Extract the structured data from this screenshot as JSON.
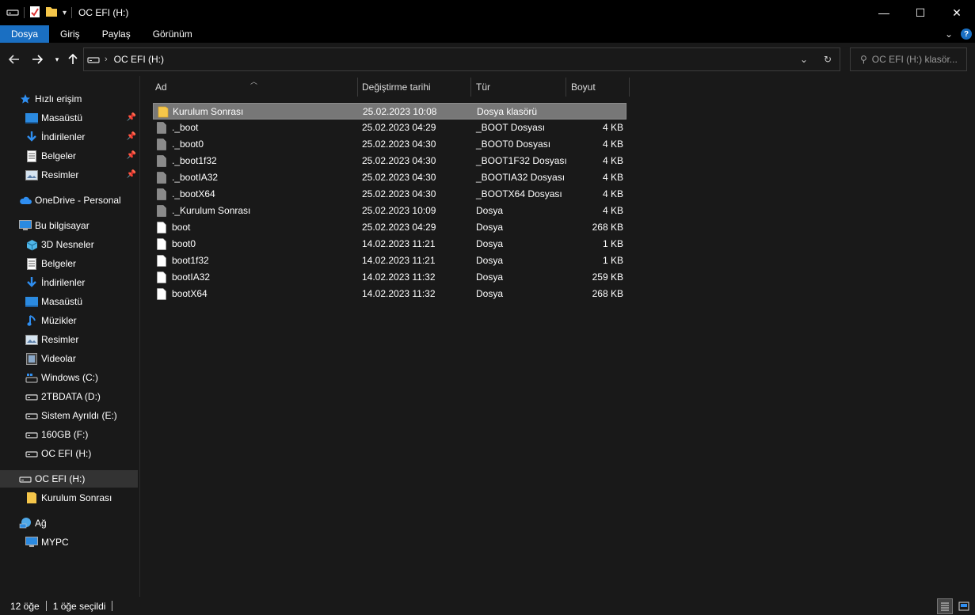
{
  "window": {
    "title": "OC EFI (H:)",
    "controls": {
      "minimize": "—",
      "maximize": "☐",
      "close": "✕"
    }
  },
  "ribbon": {
    "tabs": [
      {
        "label": "Dosya",
        "active": true
      },
      {
        "label": "Giriş"
      },
      {
        "label": "Paylaş"
      },
      {
        "label": "Görünüm"
      }
    ],
    "help": "?"
  },
  "address": {
    "location": "OC EFI (H:)",
    "search_placeholder": "OC EFI (H:) klasör..."
  },
  "sidebar": {
    "quick_access": "Hızlı erişim",
    "quick_items": [
      "Masaüstü",
      "İndirilenler",
      "Belgeler",
      "Resimler"
    ],
    "onedrive": "OneDrive - Personal",
    "this_pc": "Bu bilgisayar",
    "pc_items": [
      "3D Nesneler",
      "Belgeler",
      "İndirilenler",
      "Masaüstü",
      "Müzikler",
      "Resimler",
      "Videolar",
      "Windows (C:)",
      "2TBDATA (D:)",
      "Sistem Ayrıldı (E:)",
      "160GB (F:)",
      "OC EFI (H:)"
    ],
    "selected_drive": "OC EFI (H:)",
    "selected_child": "Kurulum Sonrası",
    "network": "Ağ",
    "network_items": [
      "MYPC"
    ]
  },
  "columns": {
    "name": "Ad",
    "date": "Değiştirme tarihi",
    "type": "Tür",
    "size": "Boyut"
  },
  "files": [
    {
      "name": "Kurulum Sonrası",
      "date": "25.02.2023 10:08",
      "type": "Dosya klasörü",
      "size": "",
      "kind": "folder",
      "selected": true
    },
    {
      "name": "._boot",
      "date": "25.02.2023 04:29",
      "type": "_BOOT Dosyası",
      "size": "4 KB",
      "kind": "gray"
    },
    {
      "name": "._boot0",
      "date": "25.02.2023 04:30",
      "type": "_BOOT0 Dosyası",
      "size": "4 KB",
      "kind": "gray"
    },
    {
      "name": "._boot1f32",
      "date": "25.02.2023 04:30",
      "type": "_BOOT1F32 Dosyası",
      "size": "4 KB",
      "kind": "gray"
    },
    {
      "name": "._bootIA32",
      "date": "25.02.2023 04:30",
      "type": "_BOOTIA32 Dosyası",
      "size": "4 KB",
      "kind": "gray"
    },
    {
      "name": "._bootX64",
      "date": "25.02.2023 04:30",
      "type": "_BOOTX64 Dosyası",
      "size": "4 KB",
      "kind": "gray"
    },
    {
      "name": "._Kurulum Sonrası",
      "date": "25.02.2023 10:09",
      "type": "Dosya",
      "size": "4 KB",
      "kind": "gray"
    },
    {
      "name": "boot",
      "date": "25.02.2023 04:29",
      "type": "Dosya",
      "size": "268 KB",
      "kind": "white"
    },
    {
      "name": "boot0",
      "date": "14.02.2023 11:21",
      "type": "Dosya",
      "size": "1 KB",
      "kind": "white"
    },
    {
      "name": "boot1f32",
      "date": "14.02.2023 11:21",
      "type": "Dosya",
      "size": "1 KB",
      "kind": "white"
    },
    {
      "name": "bootIA32",
      "date": "14.02.2023 11:32",
      "type": "Dosya",
      "size": "259 KB",
      "kind": "white"
    },
    {
      "name": "bootX64",
      "date": "14.02.2023 11:32",
      "type": "Dosya",
      "size": "268 KB",
      "kind": "white"
    }
  ],
  "status": {
    "count": "12 öğe",
    "selected": "1 öğe seçildi"
  },
  "colors": {
    "accent": "#1a6fc2",
    "folder": "#f5c64a",
    "selection": "#777777"
  }
}
